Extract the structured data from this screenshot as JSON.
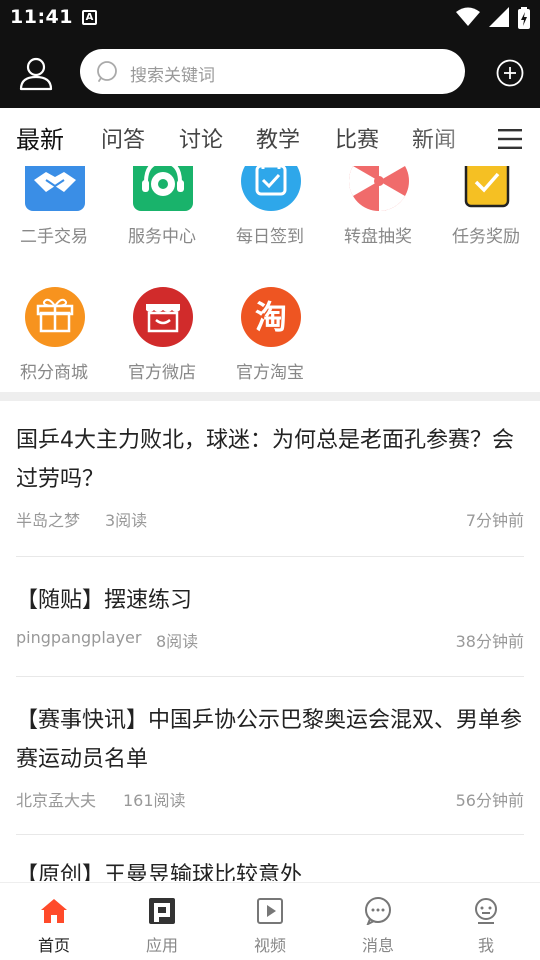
{
  "status_bar": {
    "time": "11:41",
    "notification_glyph": "A"
  },
  "search": {
    "placeholder": "搜索关键词"
  },
  "tabs": [
    {
      "label": "最新",
      "active": true
    },
    {
      "label": "问答"
    },
    {
      "label": "讨论"
    },
    {
      "label": "教学"
    },
    {
      "label": "比赛"
    },
    {
      "label": "新闻"
    }
  ],
  "quick_actions": [
    {
      "label": "二手交易",
      "icon": "handshake-icon",
      "color": "#3a8ee6"
    },
    {
      "label": "服务中心",
      "icon": "headset-icon",
      "color": "#19b36b"
    },
    {
      "label": "每日签到",
      "icon": "calendar-check-icon",
      "color": "#2ea7ea"
    },
    {
      "label": "转盘抽奖",
      "icon": "wheel-icon",
      "color": "#f06b6b"
    },
    {
      "label": "任务奖励",
      "icon": "clipboard-check-icon",
      "color": "#f5c023"
    },
    {
      "label": "积分商城",
      "icon": "gift-icon",
      "color": "#f7931e"
    },
    {
      "label": "官方微店",
      "icon": "shop-icon",
      "color": "#d12b2b"
    },
    {
      "label": "官方淘宝",
      "icon": "taobao-icon",
      "color": "#ee5522",
      "glyph": "淘"
    }
  ],
  "articles": [
    {
      "title": "国乒4大主力败北，球迷：为何总是老面孔参赛？会过劳吗？",
      "author": "半岛之梦",
      "reads": "3阅读",
      "time": "7分钟前"
    },
    {
      "title": "【随贴】摆速练习",
      "author": "pingpangplayer",
      "reads": "8阅读",
      "time": "38分钟前"
    },
    {
      "title": "【赛事快讯】中国乒协公示巴黎奥运会混双、男单参赛运动员名单",
      "author": "北京孟大夫",
      "reads": "161阅读",
      "time": "56分钟前"
    },
    {
      "title": "【原创】王曼昱输球比较意外"
    }
  ],
  "bottom_nav": [
    {
      "label": "首页",
      "icon": "home-icon",
      "active": true
    },
    {
      "label": "应用",
      "icon": "apps-icon"
    },
    {
      "label": "视频",
      "icon": "video-icon"
    },
    {
      "label": "消息",
      "icon": "message-icon"
    },
    {
      "label": "我",
      "icon": "me-icon"
    }
  ],
  "colors": {
    "accent": "#ff4a2a",
    "dark_bar": "#111111"
  }
}
